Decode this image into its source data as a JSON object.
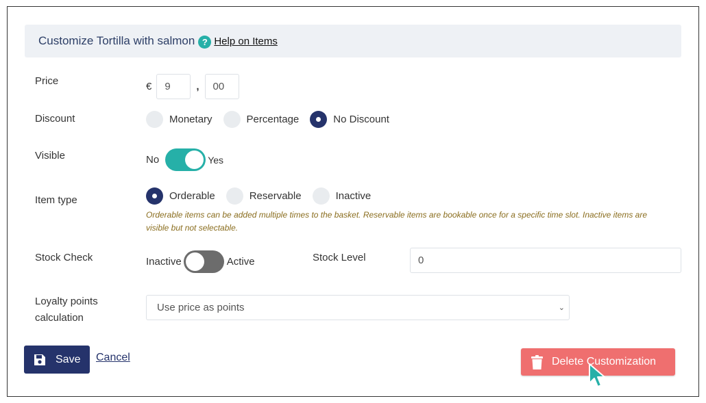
{
  "header": {
    "title": "Customize Tortilla with salmon",
    "help_icon_text": "?",
    "help_link": "Help on Items"
  },
  "price": {
    "label": "Price",
    "currency": "€",
    "whole": "9",
    "separator": ",",
    "cents": "00"
  },
  "discount": {
    "label": "Discount",
    "options": [
      "Monetary",
      "Percentage",
      "No Discount"
    ],
    "selected": "No Discount"
  },
  "visible": {
    "label": "Visible",
    "off_label": "No",
    "on_label": "Yes",
    "state": "on"
  },
  "item_type": {
    "label": "Item type",
    "options": [
      "Orderable",
      "Reservable",
      "Inactive"
    ],
    "selected": "Orderable",
    "hint": "Orderable items can be added multiple times to the basket. Reservable items are bookable once for a specific time slot. Inactive items are visible but not selectable."
  },
  "stock_check": {
    "label": "Stock Check",
    "off_label": "Inactive",
    "on_label": "Active",
    "state": "off",
    "level_label": "Stock Level",
    "level_value": "0"
  },
  "loyalty": {
    "label_line1": "Loyalty points",
    "label_line2": "calculation",
    "selected": "Use price as points"
  },
  "actions": {
    "save_label": "Save",
    "cancel_label": "Cancel",
    "delete_label": "Delete Customization"
  },
  "colors": {
    "primary": "#25336b",
    "accent": "#26b0a8",
    "danger": "#ef6f6f",
    "hint": "#8a6d1e"
  }
}
